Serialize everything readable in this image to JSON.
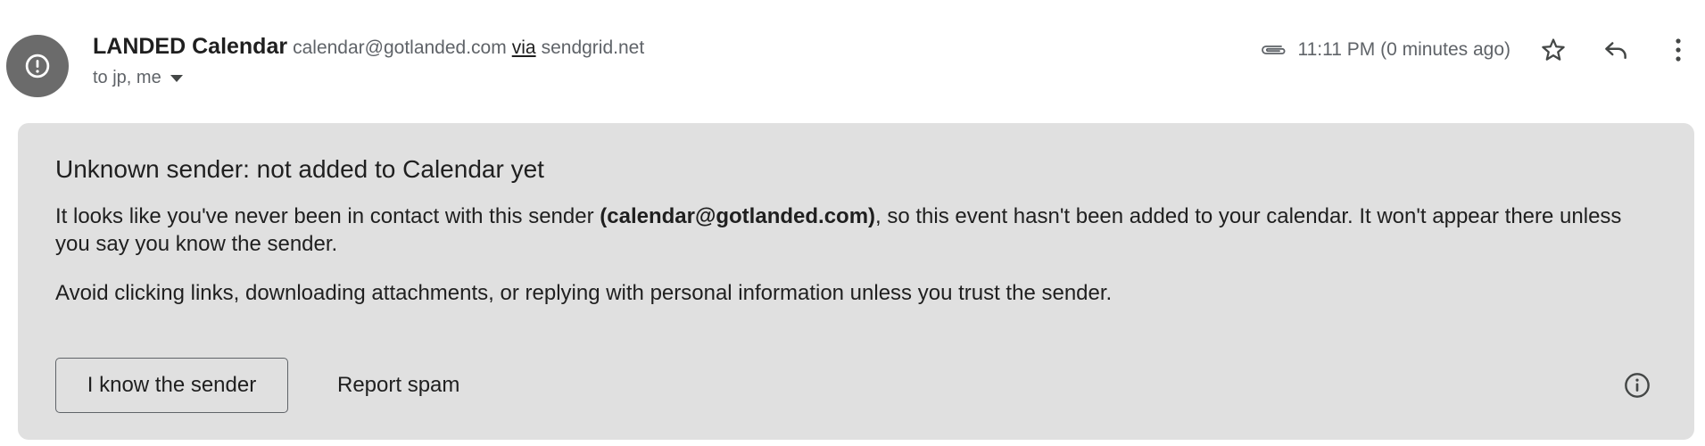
{
  "email": {
    "sender_name": "LANDED Calendar",
    "sender_email": "calendar@gotlanded.com",
    "via_label": "via",
    "via_domain": "sendgrid.net",
    "recipients": "to jp, me",
    "timestamp": "11:11 PM (0 minutes ago)"
  },
  "icons": {
    "avatar": "exclamation-circle-icon",
    "attachment": "paperclip-icon",
    "star": "star-outline-icon",
    "reply": "reply-icon",
    "more": "more-vert-icon",
    "dropdown": "caret-down-icon",
    "info": "info-icon"
  },
  "warning": {
    "title": "Unknown sender: not added to Calendar yet",
    "body_prefix": "It looks like you've never been in contact with this sender ",
    "body_bold": "(calendar@gotlanded.com)",
    "body_suffix": ", so this event hasn't been added to your calendar. It won't appear there unless you say you know the sender.",
    "advice": "Avoid clicking links, downloading attachments, or replying with personal information unless you trust the sender.",
    "know_sender_label": "I know the sender",
    "report_spam_label": "Report spam"
  },
  "colors": {
    "avatar_bg": "#6b6b6b",
    "warning_bg": "#e0e0e0",
    "secondary_text": "#5f6368",
    "primary_text": "#1f1f1f"
  }
}
